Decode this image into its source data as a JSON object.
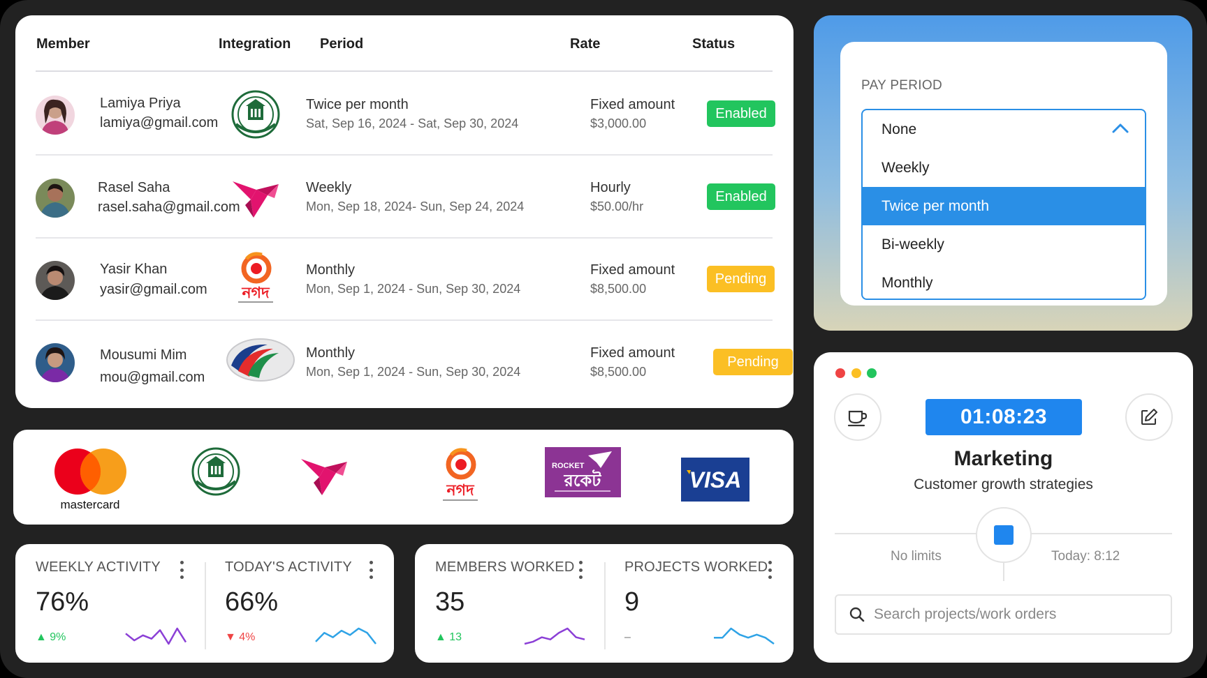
{
  "table": {
    "headers": {
      "member": "Member",
      "integration": "Integration",
      "period": "Period",
      "rate": "Rate",
      "status": "Status"
    },
    "rows": [
      {
        "name": "Lamiya Priya",
        "email": "lamiya@gmail.com",
        "integration_icon": "bangladesh-bank-seal-icon",
        "period": "Twice per month",
        "period_dates": "Sat, Sep 16, 2024 - Sat, Sep 30, 2024",
        "rate_type": "Fixed amount",
        "rate_value": "$3,000.00",
        "status": "Enabled"
      },
      {
        "name": "Rasel Saha",
        "email": "rasel.saha@gmail.com",
        "integration_icon": "bkash-bird-icon",
        "period": "Weekly",
        "period_dates": "Mon, Sep 18, 2024- Sun, Sep 24, 2024",
        "rate_type": "Hourly",
        "rate_value": "$50.00/hr",
        "status": "Enabled"
      },
      {
        "name": "Yasir Khan",
        "email": "yasir@gmail.com",
        "integration_icon": "nagad-icon",
        "period": "Monthly",
        "period_dates": "Mon, Sep 1, 2024 - Sun, Sep 30, 2024",
        "rate_type": "Fixed amount",
        "rate_value": "$8,500.00",
        "status": "Pending"
      },
      {
        "name": "Mousumi Mim",
        "email": "mou@gmail.com",
        "integration_icon": "dbbl-icon",
        "period": "Monthly",
        "period_dates": "Mon, Sep 1, 2024 - Sun, Sep 30, 2024",
        "rate_type": "Fixed amount",
        "rate_value": "$8,500.00",
        "status": "Pending"
      }
    ]
  },
  "logos": {
    "items": [
      "mastercard-logo",
      "bangladesh-bank-seal-logo",
      "bkash-bird-logo",
      "nagad-logo",
      "rocket-logo",
      "visa-logo"
    ],
    "mastercard_text": "mastercard",
    "visa_text": "VISA",
    "rocket_text": "ROCKET",
    "nagad_text": "নগদ",
    "rocket_bn_text": "রকেট"
  },
  "stats": [
    {
      "title": "WEEKLY ACTIVITY",
      "value": "76%",
      "delta": "▲ 9%",
      "trend": "up",
      "spark_color": "#8b3fd6",
      "spark": [
        6,
        10,
        7,
        9,
        4,
        12,
        3,
        11
      ]
    },
    {
      "title": "TODAY'S ACTIVITY",
      "value": "66%",
      "delta": "▼ 4%",
      "trend": "down",
      "spark_color": "#2fa3e6",
      "spark": [
        9,
        5,
        7,
        4,
        6,
        3,
        5,
        10
      ]
    },
    {
      "title": "MEMBERS WORKED",
      "value": "35",
      "delta": "▲ 13",
      "trend": "up",
      "spark_color": "#8b3fd6",
      "spark": [
        10,
        9,
        7,
        8,
        5,
        3,
        7,
        8
      ]
    },
    {
      "title": "PROJECTS WORKED",
      "value": "9",
      "delta": "–",
      "trend": "none",
      "spark_color": "#2fa3e6",
      "spark": [
        6,
        6,
        3,
        5,
        6,
        5,
        6,
        8
      ]
    }
  ],
  "pay_period": {
    "label": "PAY PERIOD",
    "options": [
      "None",
      "Weekly",
      "Twice per month",
      "Bi-weekly",
      "Monthly"
    ],
    "selected": "Twice per month",
    "accent": "#2a8fe6"
  },
  "timer": {
    "time": "01:08:23",
    "project": "Marketing",
    "subtitle": "Customer growth strategies",
    "limit_left": "No limits",
    "limit_right": "Today: 8:12",
    "search_placeholder": "Search projects/work orders",
    "accent": "#1f86ee"
  }
}
